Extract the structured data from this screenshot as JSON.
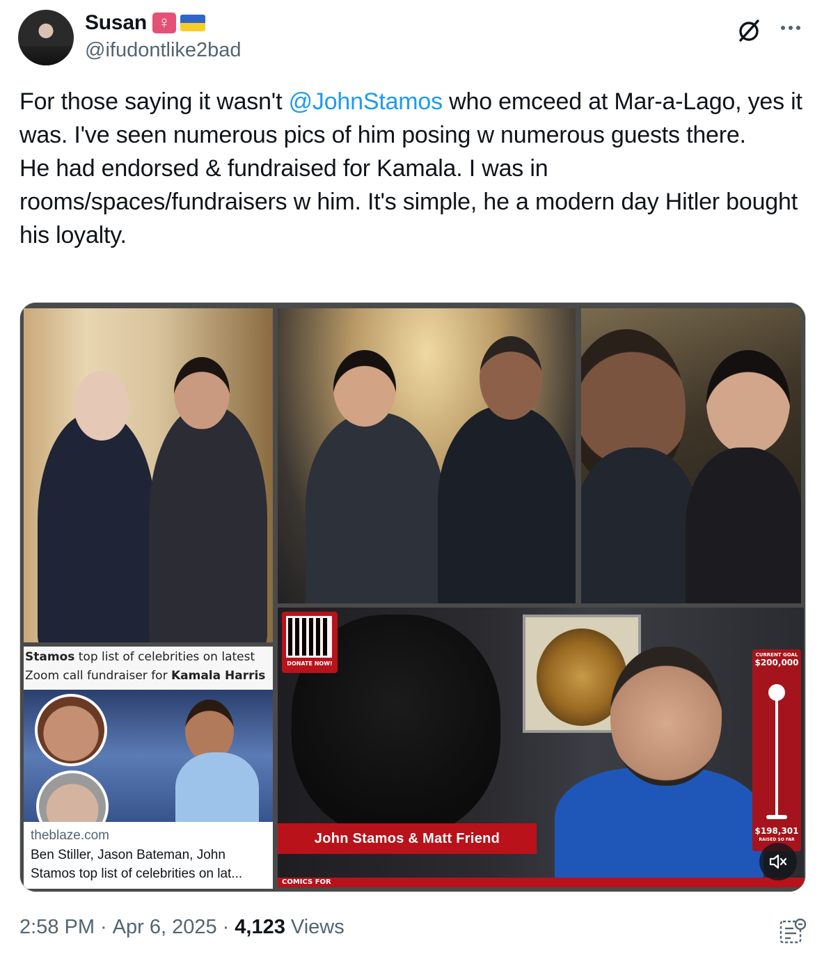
{
  "author": {
    "display_name": "Susan",
    "badge_symbol": "♀",
    "handle": "@ifudontlike2bad"
  },
  "tweet": {
    "text_line1_before": "For those saying it wasn't ",
    "mention": "@JohnStamos",
    "text_line1_after": " who emceed at Mar-a-Lago, yes it was. I've seen numerous pics of him posing w numerous guests there.",
    "text_paragraph2": "He had endorsed & fundraised for Kamala. I was in rooms/spaces/fundraisers w him. It's simple, he a modern day Hitler bought his loyalty."
  },
  "media": {
    "caption_bold1": "Stamos",
    "caption_mid1": " top list of celebrities on latest",
    "caption_line2": "Zoom call fundraiser for ",
    "caption_bold2": "Kamala Harris",
    "link_domain": "theblaze.com",
    "link_title_line1": "Ben Stiller, Jason Bateman, John",
    "link_title_line2": "Stamos top list of celebrities on lat...",
    "qr_label": "DONATE NOW!",
    "banner_text": "John Stamos & Matt Friend",
    "comics_label": "COMICS FOR",
    "goal_label": "CURRENT GOAL",
    "goal_amount": "$200,000",
    "raised_amount": "$198,301",
    "raised_label": "RAISED SO FAR"
  },
  "footer": {
    "time": "2:58 PM",
    "separator": "·",
    "date": "Apr 6, 2025",
    "views_count": "4,123",
    "views_label": "Views"
  },
  "colors": {
    "accent": "#1d9bf0",
    "text": "#0f1419",
    "muted": "#536471"
  },
  "icons": [
    "grok-icon",
    "more-icon",
    "mute-icon",
    "analytics-icon"
  ]
}
